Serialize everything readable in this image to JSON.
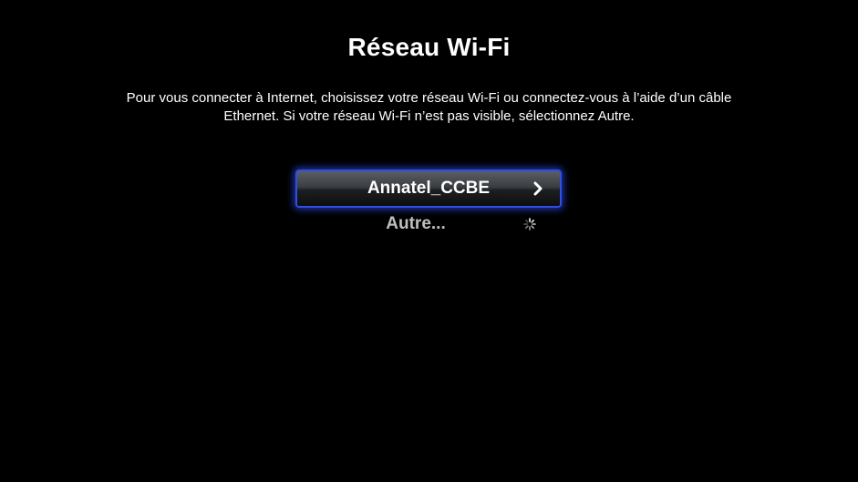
{
  "screen": {
    "title": "Réseau Wi-Fi",
    "description": "Pour vous connecter à Internet, choisissez votre réseau Wi-Fi ou connectez-vous à l’aide d’un câble Ethernet. Si votre réseau Wi-Fi n’est pas visible, sélectionnez Autre."
  },
  "networks": {
    "selected_label": "Annatel_CCBE",
    "other_label": "Autre...",
    "selected_icon": "chevron-right-icon",
    "other_icon": "loading-spinner-icon"
  },
  "colors": {
    "background": "#000000",
    "focus_ring": "#2f4fe0",
    "text": "#ffffff",
    "dim_text": "#bfbfbf"
  }
}
